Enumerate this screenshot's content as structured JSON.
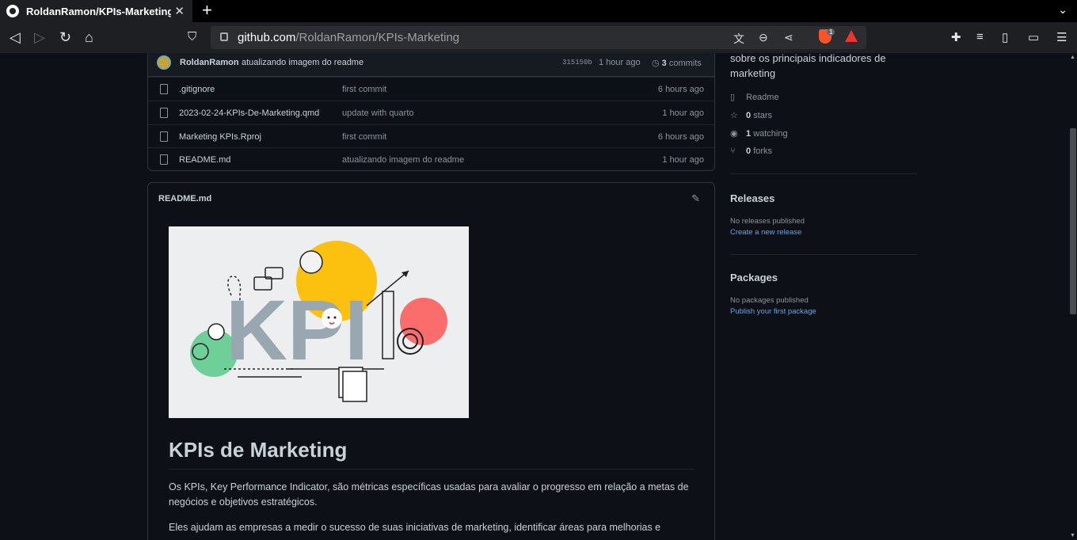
{
  "browser": {
    "tab_title": "RoldanRamon/KPIs-Marketing",
    "tab_close": "✕",
    "new_tab": "+",
    "url_host": "github.com",
    "url_path": "/RoldanRamon/KPIs-Marketing",
    "brave_badge": "1"
  },
  "commit": {
    "author": "RoldanRamon",
    "message": "atualizando imagem do readme",
    "hash": "315150b",
    "time": "1 hour ago",
    "count": "3",
    "count_label": "commits"
  },
  "files": [
    {
      "name": ".gitignore",
      "message": "first commit",
      "time": "6 hours ago"
    },
    {
      "name": "2023-02-24-KPIs-De-Marketing.qmd",
      "message": "update with quarto",
      "time": "1 hour ago"
    },
    {
      "name": "Marketing KPIs.Rproj",
      "message": "first commit",
      "time": "6 hours ago"
    },
    {
      "name": "README.md",
      "message": "atualizando imagem do readme",
      "time": "1 hour ago"
    }
  ],
  "readme": {
    "header": "README.md",
    "image_text": "KPI",
    "title": "KPIs de Marketing",
    "p1": "Os KPIs, Key Performance Indicator, são métricas específicas usadas para avaliar o progresso em relação a metas de negócios e objetivos estratégicos.",
    "p2": "Eles ajudam as empresas a medir o sucesso de suas iniciativas de marketing, identificar áreas para melhorias e"
  },
  "sidebar": {
    "about": "sobre os principais indicadores de marketing",
    "readme_link": "Readme",
    "stars_count": "0",
    "stars_label": "stars",
    "watching_count": "1",
    "watching_label": "watching",
    "forks_count": "0",
    "forks_label": "forks",
    "releases_title": "Releases",
    "releases_empty": "No releases published",
    "releases_link": "Create a new release",
    "packages_title": "Packages",
    "packages_empty": "No packages published",
    "packages_link": "Publish your first package"
  }
}
